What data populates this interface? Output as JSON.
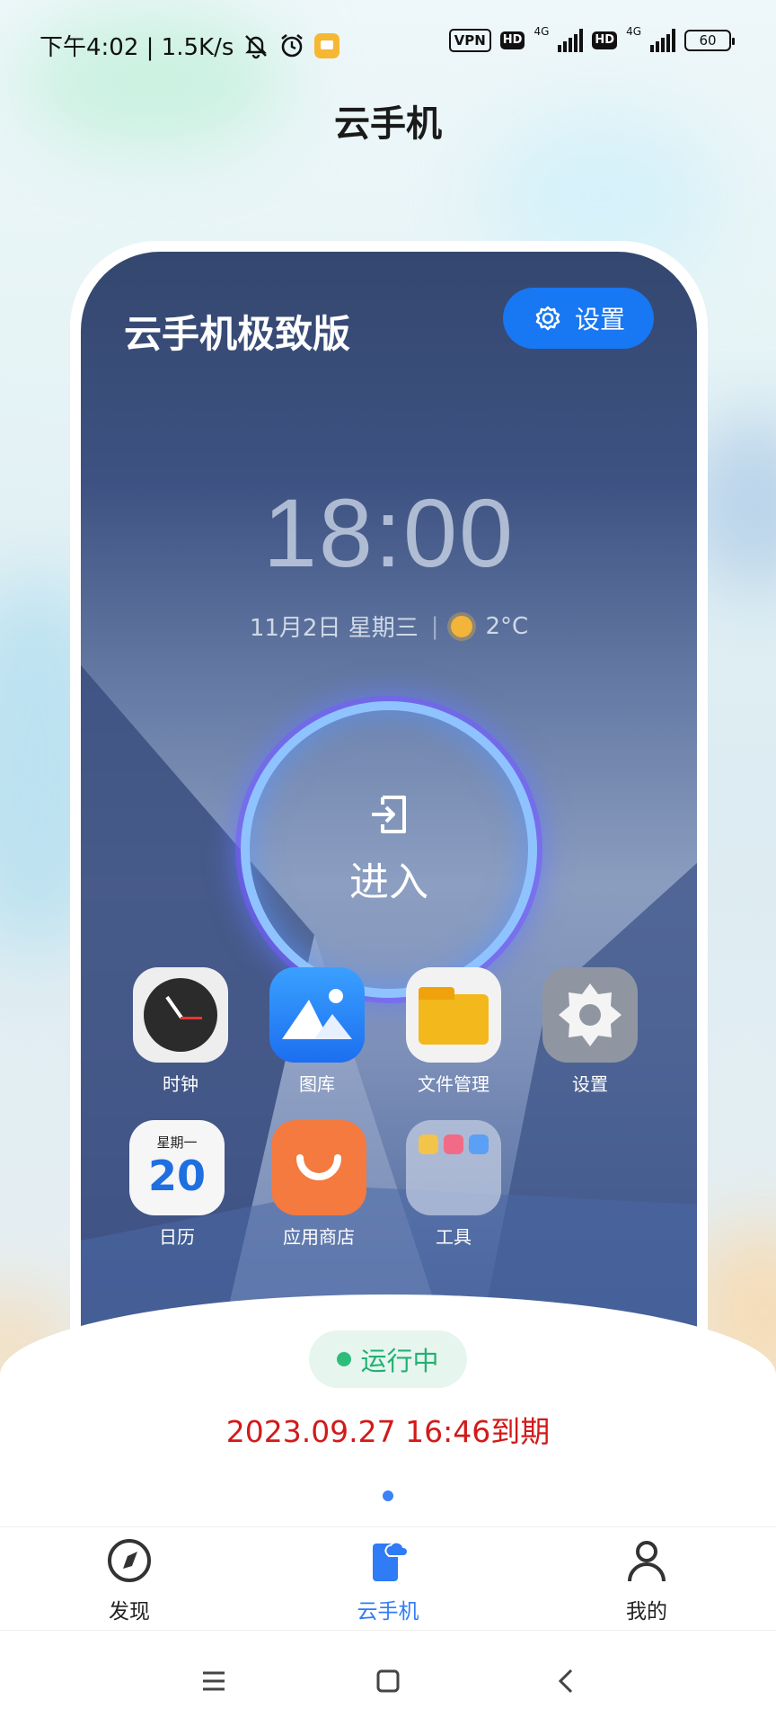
{
  "status_bar": {
    "time_speed": "下午4:02 | 1.5K/s",
    "vpn": "VPN",
    "hd1": "HD",
    "net1": "4G",
    "hd2": "HD",
    "net2": "4G",
    "battery": "60"
  },
  "header": {
    "title": "云手机"
  },
  "phone_card": {
    "name": "云手机极致版",
    "settings_label": "设置",
    "clock": "18:00",
    "date": "11月2日 星期三",
    "temp": "2°C",
    "enter_label": "进入",
    "apps": [
      {
        "label": "时钟"
      },
      {
        "label": "图库"
      },
      {
        "label": "文件管理"
      },
      {
        "label": "设置"
      },
      {
        "label": "日历",
        "weekday": "星期一",
        "day": "20"
      },
      {
        "label": "应用商店"
      },
      {
        "label": "工具"
      }
    ]
  },
  "status": {
    "label": "运行中",
    "expire": "2023.09.27 16:46到期"
  },
  "bottom_nav": {
    "items": [
      {
        "label": "发现",
        "icon": "compass-icon"
      },
      {
        "label": "云手机",
        "icon": "cloud-phone-icon",
        "active": true
      },
      {
        "label": "我的",
        "icon": "person-icon"
      }
    ]
  },
  "colors": {
    "accent": "#2f7cf6",
    "running": "#22b172",
    "expire": "#d21a1a",
    "settings_btn": "#1877f2"
  }
}
